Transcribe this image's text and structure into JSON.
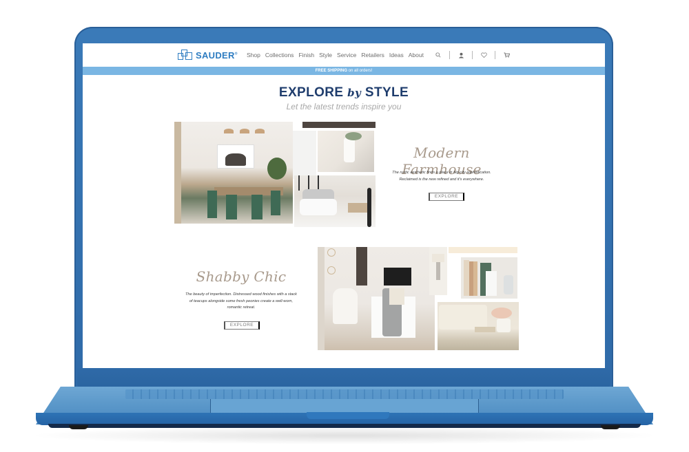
{
  "site": {
    "brand": "SAUDER",
    "nav": [
      "Shop",
      "Collections",
      "Finish",
      "Style",
      "Service",
      "Retailers",
      "Ideas",
      "About"
    ],
    "header_icons": [
      "search-icon",
      "account-icon",
      "wishlist-heart-icon",
      "cart-icon"
    ],
    "promo": {
      "bold": "FREE SHIPPING",
      "rest": " on all orders!"
    },
    "colors": {
      "brand_blue": "#2d7cc1",
      "promo_bar": "#7ab6e3",
      "title_navy": "#1f3d6d",
      "style_taupe": "#a89a8c",
      "laptop_blue": "#3a7ab8"
    }
  },
  "hero": {
    "title_part1": "EXPLORE ",
    "title_part2": "by",
    "title_part3": " STYLE",
    "subtitle": "Let the latest trends inspire you"
  },
  "styles": [
    {
      "name": "Modern Farmhouse",
      "description_line1": "The rustic aesthetic finds a place in big-city sophistication.",
      "description_line2": "Reclaimed is the new refined and it's everywhere.",
      "button": "EXPLORE",
      "images": [
        "dining-room-photo",
        "antler-decor-photo",
        "bedroom-pillows-photo"
      ]
    },
    {
      "name": "Shabby Chic",
      "description_line1": "The beauty of imperfection. Distressed wood finishes with a stack",
      "description_line2": "of teacups alongside some fresh peonies create a well-worn,",
      "description_line3": "romantic retreat.",
      "button": "EXPLORE",
      "images": [
        "home-office-photo",
        "bookshelf-decor-photo",
        "sofa-peonies-photo"
      ]
    }
  ]
}
